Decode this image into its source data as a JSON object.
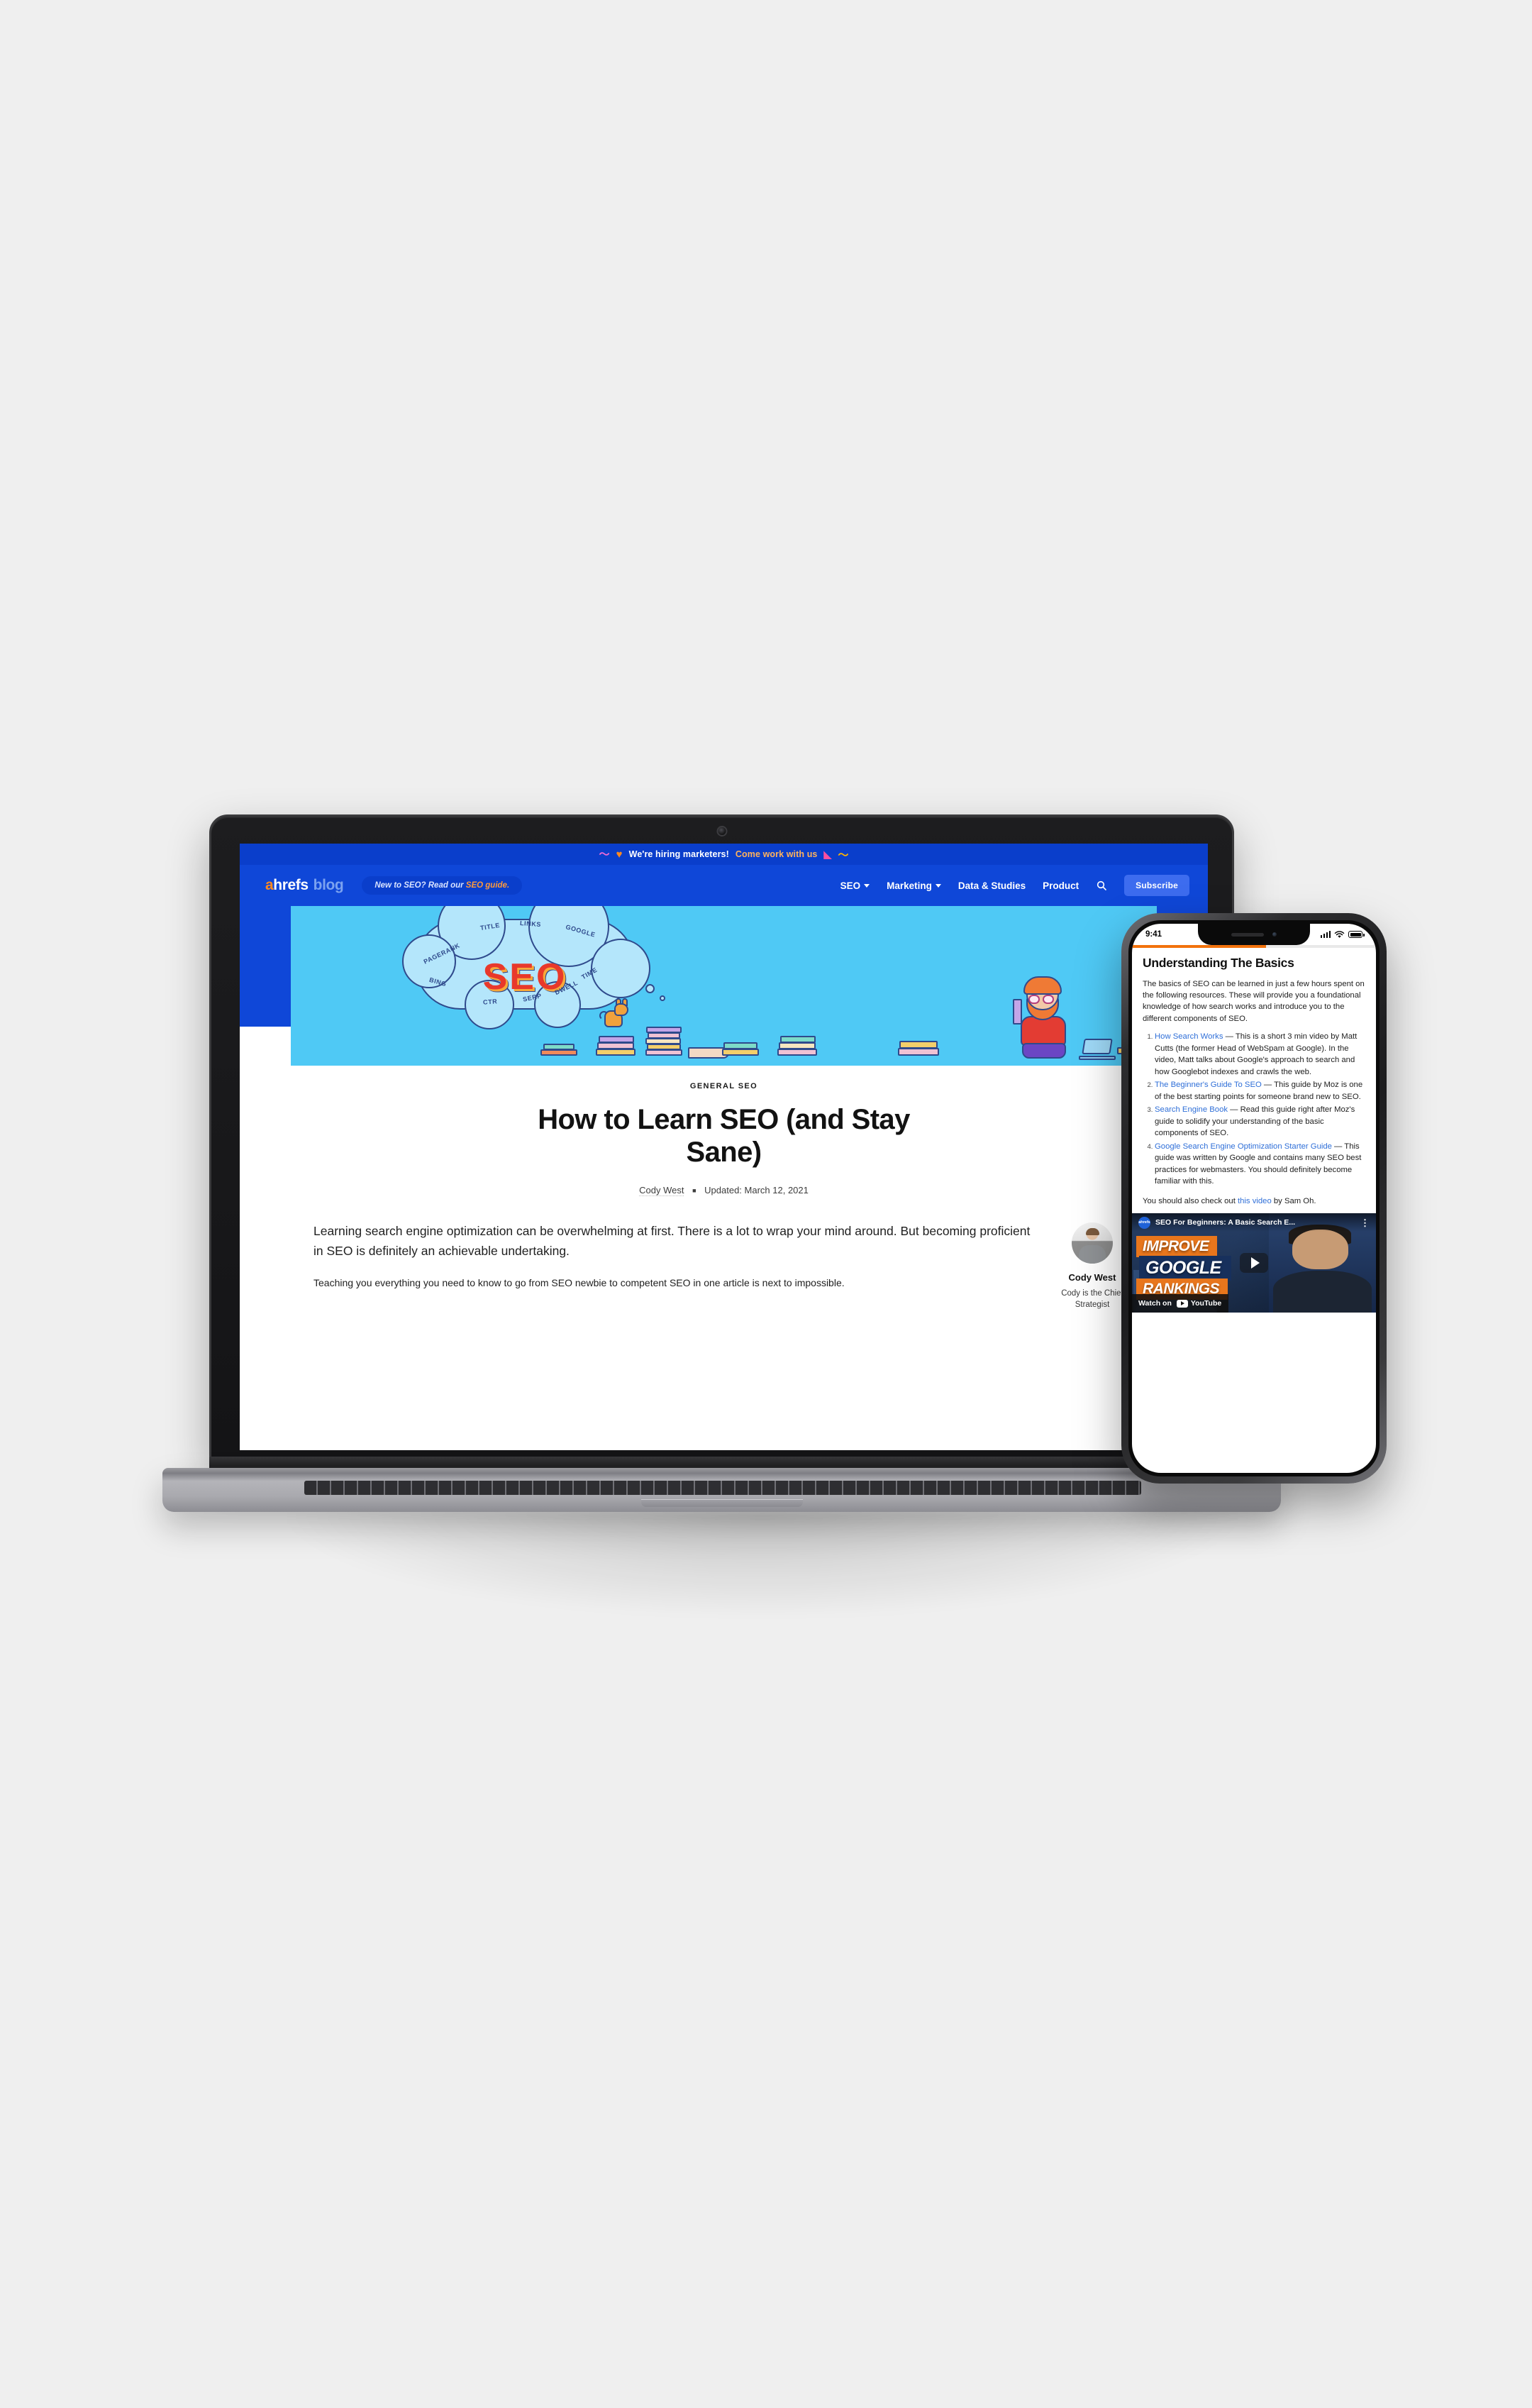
{
  "scene": {
    "background_color": "#efefef",
    "devices": [
      "macbook-pro",
      "iphone"
    ]
  },
  "laptop": {
    "device_label": "laptop-mockup",
    "page": {
      "announcement": {
        "squiggle_icon": "~",
        "heart_icon": "♥",
        "text": "We're hiring marketers!",
        "link_text": "Come work with us",
        "flame_icon": "flame",
        "wave_icon": "wave"
      },
      "nav": {
        "logo": {
          "a": "a",
          "hrefs": "hrefs",
          "blog": "blog"
        },
        "pill": {
          "prefix": "New to SEO? Read our ",
          "link": "SEO guide."
        },
        "links": [
          {
            "label": "SEO",
            "has_caret": true
          },
          {
            "label": "Marketing",
            "has_caret": true
          },
          {
            "label": "Data & Studies",
            "has_caret": false
          },
          {
            "label": "Product",
            "has_caret": false
          }
        ],
        "search_icon": "search-icon",
        "subscribe_label": "Subscribe"
      },
      "hero": {
        "background_color": "#4fc9f5",
        "seo_word": "SEO",
        "keywords": [
          "PAGERANK",
          "TITLE",
          "LINKS",
          "GOOGLE",
          "BING",
          "CTR",
          "SERP",
          "DWELL",
          "TIME"
        ]
      },
      "article": {
        "kicker": "GENERAL SEO",
        "title": "How to Learn SEO (and Stay Sane)",
        "author": "Cody West",
        "separator": "■",
        "updated": "Updated: March 12, 2021",
        "lede": "Learning search engine optimization can be overwhelming at first. There is a lot to wrap your mind around. But becoming proficient in SEO is definitely an achievable undertaking.",
        "paragraph": "Teaching you everything you need to know to go from SEO newbie to competent SEO in one article is next to impossible.",
        "sidebar": {
          "avatar": "author-avatar",
          "name": "Cody West",
          "bio": "Cody is the Chief Strategist"
        }
      }
    }
  },
  "phone": {
    "device_label": "phone-mockup",
    "status_bar": {
      "time": "9:41",
      "signal_icon": "cellular-bars",
      "wifi_icon": "wifi",
      "battery_icon": "battery"
    },
    "reading_progress_color": "#f2720c",
    "article": {
      "heading": "Understanding The Basics",
      "intro": "The basics of SEO can be learned in just a few hours spent on the following resources. These will provide you a foundational knowledge of how search works and introduce you to the different components of SEO.",
      "list": [
        {
          "link": "How Search Works",
          "text": " — This is a short 3 min video by Matt Cutts (the former Head of WebSpam at Google). In the video, Matt talks about Google's approach to search and how Googlebot indexes and crawls the web."
        },
        {
          "link": "The Beginner's Guide To SEO",
          "text": " — This guide by Moz is one of the best starting points for someone brand new to SEO."
        },
        {
          "link": "Search Engine Book",
          "text": " — Read this guide right after Moz's guide to solidify your understanding of the basic components of SEO."
        },
        {
          "link": "Google Search Engine Optimization Starter Guide",
          "text": " — This guide was written by Google and contains many SEO best practices for webmasters. You should definitely become familiar with this."
        }
      ],
      "closing_before": "You should also check out ",
      "closing_link": "this video",
      "closing_after": " by Sam Oh."
    },
    "video": {
      "channel_badge": "ahrefs",
      "title": "SEO For Beginners: A Basic Search E...",
      "kebab_icon": "more-vertical-icon",
      "play_icon": "play-icon",
      "thumbnail_lines": [
        "IMPROVE",
        "GOOGLE",
        "RANKINGS"
      ],
      "watch_on": "Watch on",
      "platform": "YouTube"
    }
  },
  "colors": {
    "brand_blue": "#0f47d8",
    "announcement_blue": "#0a3ecb",
    "hero_cyan": "#4fc9f5",
    "accent_orange": "#ff8a1f",
    "link_blue": "#2f6fd8",
    "progress_orange": "#f2720c"
  }
}
